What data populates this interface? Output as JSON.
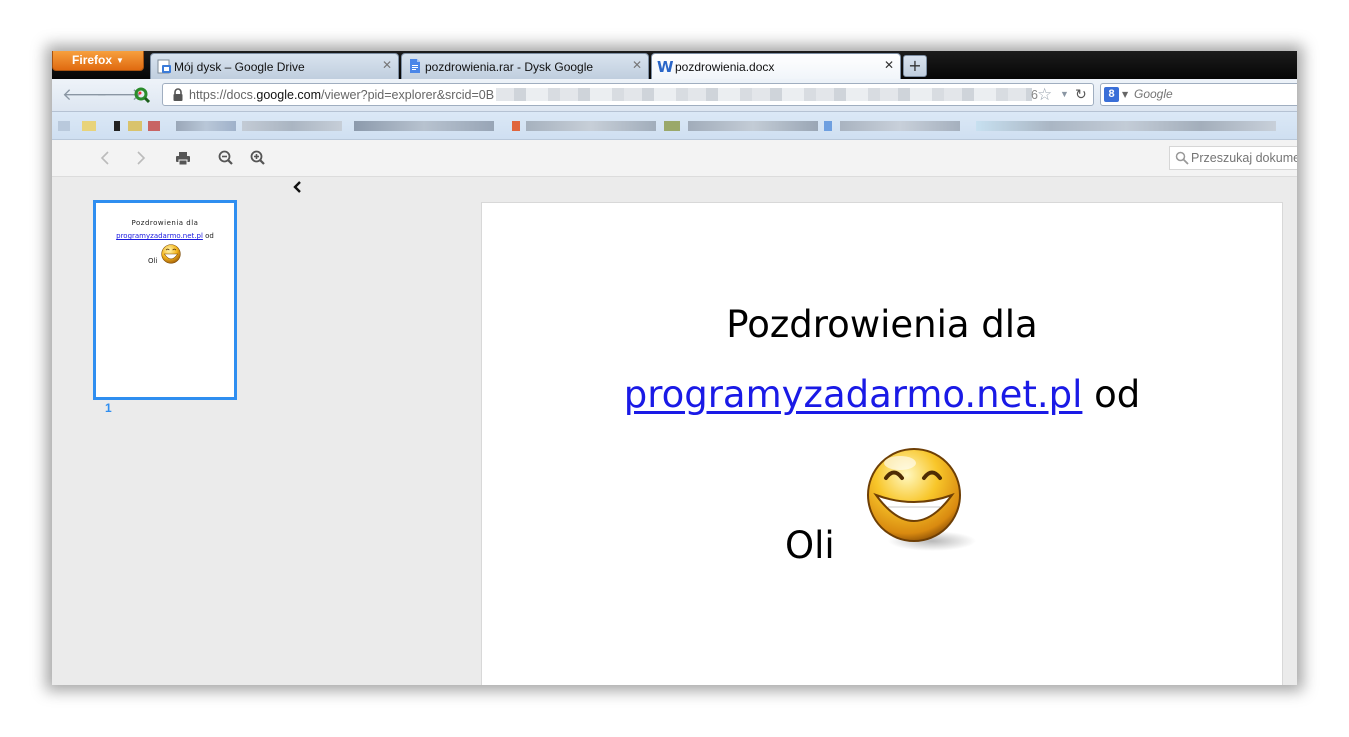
{
  "browser": {
    "menu_button": "Firefox",
    "tabs": [
      {
        "label": "Mój dysk – Google Drive",
        "icon": "google-drive-icon",
        "active": false
      },
      {
        "label": "pozdrowienia.rar - Dysk Google",
        "icon": "document-icon",
        "active": false
      },
      {
        "label": "pozdrowienia.docx",
        "icon": "word-icon",
        "active": true
      }
    ],
    "url": {
      "prefix": "https://docs.",
      "host": "google.com",
      "path": "/viewer?pid=explorer&srcid=0B",
      "suffix": "6"
    },
    "search_placeholder": "Google"
  },
  "viewer": {
    "search_placeholder": "Przeszukaj dokument",
    "thumbnail": {
      "line1": "Pozdrowienia dla",
      "link": "programyzadarmo.net.pl",
      "after_link": " od",
      "signature": "Oli",
      "page_number": "1"
    },
    "document": {
      "line1": "Pozdrowienia dla",
      "link": "programyzadarmo.net.pl",
      "after_link": " od",
      "signature": "Oli"
    }
  },
  "colors": {
    "link": "#1a1ae6",
    "selection": "#2f8ef0",
    "firefox_orange": "#e8781a"
  }
}
